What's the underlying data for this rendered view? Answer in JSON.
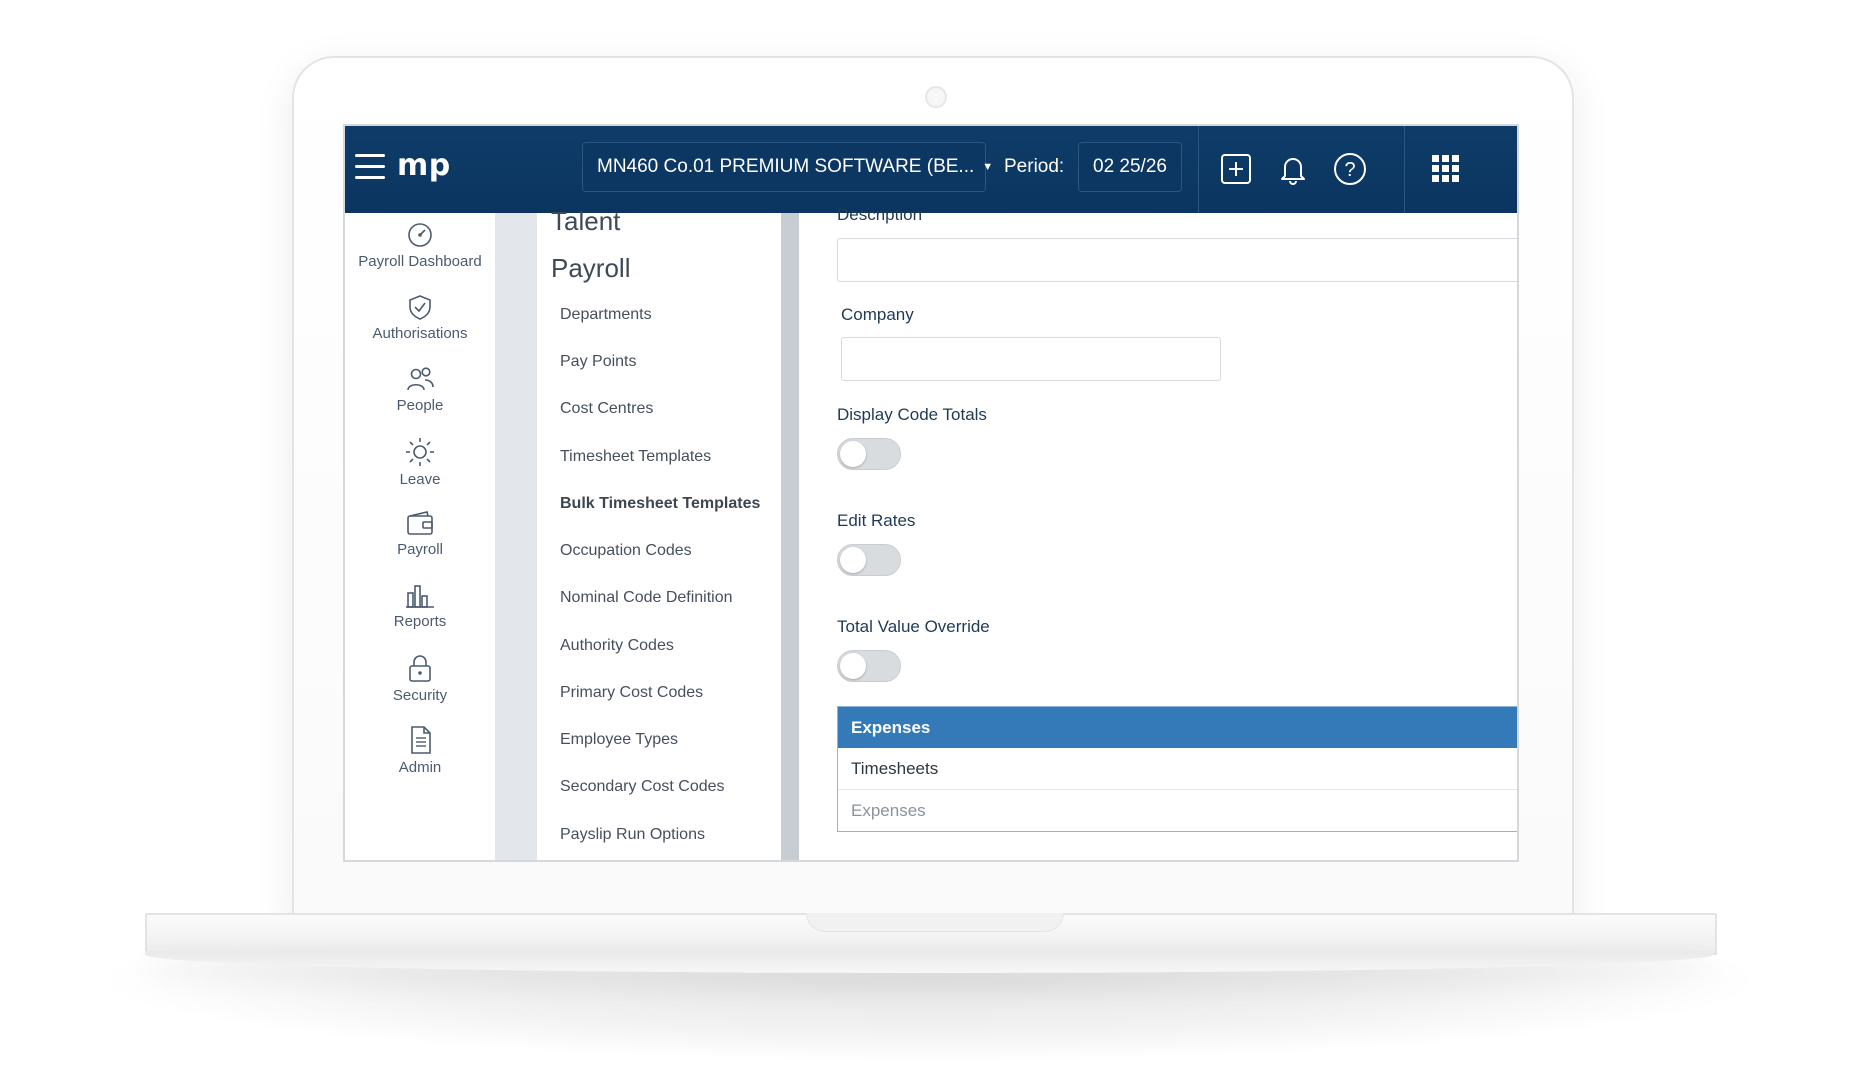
{
  "topbar": {
    "logo": "mp",
    "company": "MN460 Co.01 PREMIUM SOFTWARE (BE...",
    "period_label": "Period:",
    "period_value": "02 25/26",
    "icons": [
      "plus-square-icon",
      "bell-icon",
      "help-icon",
      "apps-grid-icon"
    ]
  },
  "nav": {
    "items": [
      {
        "label": "Payroll Dashboard",
        "icon": "gauge-icon"
      },
      {
        "label": "Authorisations",
        "icon": "shield-check-icon"
      },
      {
        "label": "People",
        "icon": "people-icon"
      },
      {
        "label": "Leave",
        "icon": "sun-icon"
      },
      {
        "label": "Payroll",
        "icon": "wallet-icon"
      },
      {
        "label": "Reports",
        "icon": "bar-chart-icon"
      },
      {
        "label": "Security",
        "icon": "lock-icon"
      },
      {
        "label": "Admin",
        "icon": "document-icon"
      }
    ]
  },
  "submenu": {
    "section_prev": "Talent",
    "section": "Payroll",
    "items": [
      "Departments",
      "Pay Points",
      "Cost Centres",
      "Timesheet Templates",
      "Bulk Timesheet Templates",
      "Occupation Codes",
      "Nominal Code Definition",
      "Authority Codes",
      "Primary Cost Codes",
      "Employee Types",
      "Secondary Cost Codes",
      "Payslip Run Options"
    ],
    "active_item": "Bulk Timesheet Templates"
  },
  "form": {
    "description_label": "Description",
    "description_value": "",
    "company_label": "Company",
    "company_value": "",
    "display_code_totals_label": "Display Code Totals",
    "display_code_totals_on": false,
    "edit_rates_label": "Edit Rates",
    "edit_rates_on": false,
    "total_value_override_label": "Total Value Override",
    "total_value_override_on": false,
    "type_options": [
      "Expenses",
      "Timesheets"
    ],
    "type_selected": "Expenses",
    "type_placeholder": "Expenses"
  },
  "colors": {
    "topbar": "#0e3c68",
    "accent": "#347ab8",
    "label": "#1f3a56"
  }
}
